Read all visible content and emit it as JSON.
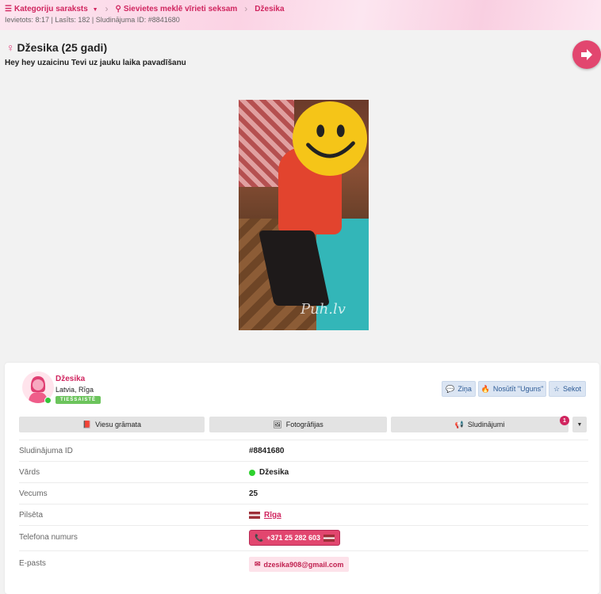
{
  "breadcrumb": {
    "items": [
      {
        "label": "Kategoriju saraksts",
        "icon": "list-icon"
      },
      {
        "label": "Sievietes meklē vīrieti seksam",
        "icon": "location-pin-icon"
      },
      {
        "label": "Džesika"
      }
    ]
  },
  "meta": "Ievietots: 8:17 | Lasīts: 182 | Sludinājuma ID: #8841680",
  "listing": {
    "title": "Džesika (25 gadi)",
    "description": "Hey hey uzaicinu Tevi uz jauku laika pavadīšanu",
    "watermark": "Puh.lv"
  },
  "profile": {
    "name": "Džesika",
    "location": "Latvia, Rīga",
    "badge": "TIEŠSAISTĒ"
  },
  "actions": {
    "message": "Ziņa",
    "fire": "Nosūtīt \"Uguns\"",
    "follow": "Sekot"
  },
  "tabs": {
    "guestbook": "Viesu grāmata",
    "photos": "Fotogrāfijas",
    "ads": "Sludinājumi",
    "ads_count": "1"
  },
  "details": {
    "id_label": "Sludinājuma ID",
    "id_value": "#8841680",
    "name_label": "Vārds",
    "name_value": "Džesika",
    "age_label": "Vecums",
    "age_value": "25",
    "city_label": "Pilsēta",
    "city_value": "Rīga",
    "phone_label": "Telefona numurs",
    "phone_value": "+371 25 282 603",
    "email_label": "E-pasts",
    "email_value": "dzesika908@gmail.com"
  },
  "colors": {
    "accent": "#d0255f",
    "button_pink": "#e2466f",
    "online_green": "#35c43a"
  }
}
